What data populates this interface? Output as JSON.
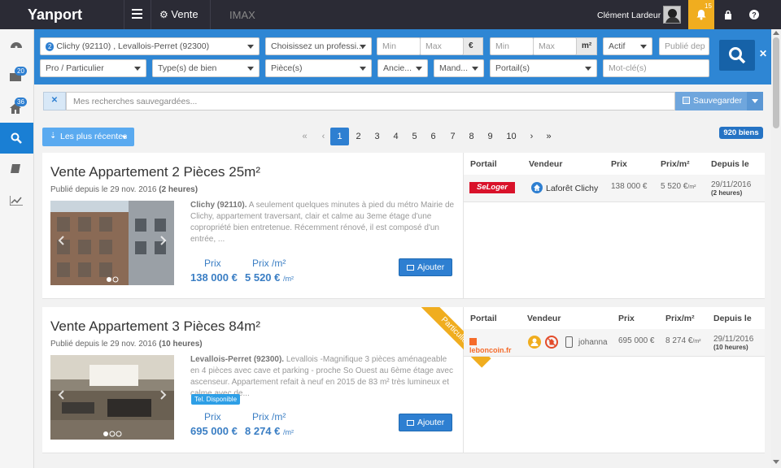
{
  "topbar": {
    "logo": "Yanport",
    "module": "Vente",
    "other_module": "IMAX",
    "user_name": "Clément Lardeur",
    "notifications": "15"
  },
  "sidebar": {
    "items": [
      {
        "icon": "dashboard-icon"
      },
      {
        "icon": "inbox-icon",
        "badge": "20"
      },
      {
        "icon": "home-icon",
        "badge": "36"
      },
      {
        "icon": "search-icon"
      },
      {
        "icon": "book-icon"
      },
      {
        "icon": "chart-icon"
      }
    ]
  },
  "filters": {
    "location_count": "2",
    "location_value": "Clichy (92110) , Levallois-Perret (92300)",
    "professional_placeholder": "Choisissez un professi...",
    "price_min": "Min",
    "price_max": "Max",
    "price_unit": "€",
    "surface_min": "Min",
    "surface_max": "Max",
    "surface_unit": "m²",
    "status": "Actif",
    "published_placeholder": "Publié dep",
    "pro_particulier": "Pro / Particulier",
    "property_type": "Type(s) de bien",
    "rooms": "Pièce(s)",
    "age": "Ancie...",
    "mandate": "Mand...",
    "portals": "Portail(s)",
    "keyword_placeholder": "Mot-clé(s)"
  },
  "saved_search": {
    "placeholder": "Mes recherches sauvegardées...",
    "save_label": "Sauvegarder"
  },
  "results": {
    "sort_label": "Les plus récentes",
    "count_badge": "920 biens",
    "pages": [
      "1",
      "2",
      "3",
      "4",
      "5",
      "6",
      "7",
      "8",
      "9",
      "10"
    ],
    "first": "«",
    "prev": "‹",
    "next": "›",
    "last": "»"
  },
  "table_headers": {
    "portal": "Portail",
    "seller": "Vendeur",
    "price": "Prix",
    "price_m2": "Prix/m²",
    "since": "Depuis le"
  },
  "listings": [
    {
      "title": "Vente Appartement 2 Pièces 25m²",
      "published_prefix": "Publié depuis le 29 nov. 2016",
      "published_ago": "(2 heures)",
      "desc_city": "Clichy (92110).",
      "desc_text": " A seulement quelques minutes à pied du métro Mairie de Clichy, appartement traversant, clair et calme au 3eme étage d'une copropriété bien entretenue. Récemment rénové, il est composé d'un entrée, ...",
      "price_label": "Prix",
      "price": "138 000 €",
      "price_m2_label": "Prix /m²",
      "price_m2": "5 520 €",
      "price_m2_unit": "/m²",
      "add_label": "Ajouter",
      "row": {
        "portal": "SeLoger",
        "seller": "Laforêt Clichy",
        "price": "138 000 €",
        "price_m2": "5 520 €",
        "price_m2_unit": "/m²",
        "date": "29/11/2016",
        "ago": "(2 heures)"
      }
    },
    {
      "title": "Vente Appartement 3 Pièces 84m²",
      "published_prefix": "Publié depuis le 29 nov. 2016",
      "published_ago": "(10 heures)",
      "ribbon": "Particulier",
      "desc_city": "Levallois-Perret (92300).",
      "desc_text": " Levallois -Magnifique 3 pièces aménageable en 4 pièces avec cave et parking - proche So Ouest au 6ème étage avec ascenseur. Appartement refait à neuf en 2015 de 83 m² très lumineux et calme avec de...",
      "tag": "Tel. Disponible",
      "price_label": "Prix",
      "price": "695 000 €",
      "price_m2_label": "Prix /m²",
      "price_m2": "8 274 €",
      "price_m2_unit": "/m²",
      "add_label": "Ajouter",
      "row": {
        "portal": "leboncoin.fr",
        "seller": "johanna",
        "price": "695 000 €",
        "price_m2": "8 274 €",
        "price_m2_unit": "/m²",
        "date": "29/11/2016",
        "ago": "(10 heures)"
      }
    }
  ]
}
